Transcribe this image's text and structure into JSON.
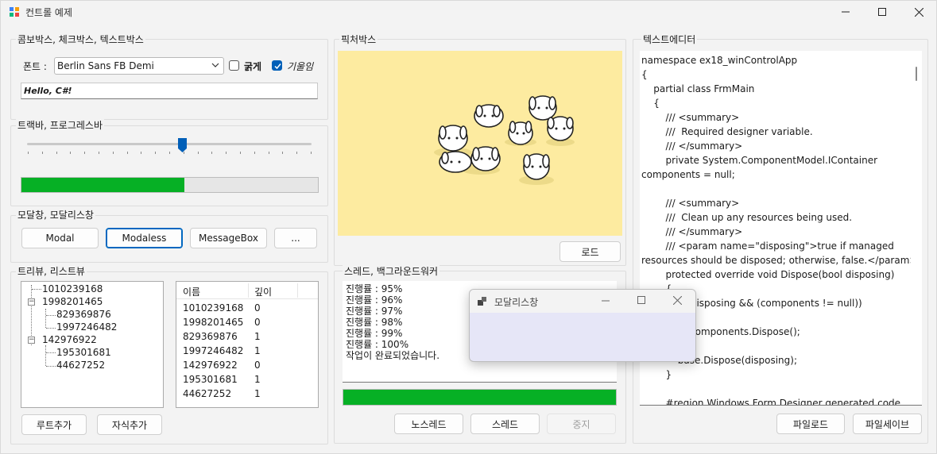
{
  "window": {
    "title": "컨트롤 예제"
  },
  "combo_group": {
    "label": "콤보박스, 체크박스, 텍스트박스",
    "font_label": "폰트 :",
    "font_value": "Berlin Sans FB Demi",
    "bold_label": "굵게",
    "italic_label": "기울임",
    "bold_checked": false,
    "italic_checked": true,
    "sample_text": "Hello, C#!"
  },
  "track_group": {
    "label": "트랙바, 프로그레스바",
    "progress_fraction": 0.55
  },
  "modal_group": {
    "label": "모달창, 모달리스창",
    "buttons": [
      "Modal",
      "Modaless",
      "MessageBox",
      "..."
    ]
  },
  "tree_group": {
    "label": "트리뷰, 리스트뷰",
    "tree": [
      {
        "text": "1010239168",
        "level": 0,
        "expander": ""
      },
      {
        "text": "1998201465",
        "level": 0,
        "expander": "−"
      },
      {
        "text": "829369876",
        "level": 1,
        "expander": ""
      },
      {
        "text": "1997246482",
        "level": 1,
        "expander": ""
      },
      {
        "text": "142976922",
        "level": 0,
        "expander": "−"
      },
      {
        "text": "195301681",
        "level": 1,
        "expander": ""
      },
      {
        "text": "44627252",
        "level": 1,
        "expander": ""
      }
    ],
    "list_headers": [
      "이름",
      "깊이"
    ],
    "list_rows": [
      [
        "1010239168",
        "0"
      ],
      [
        "1998201465",
        "0"
      ],
      [
        "829369876",
        "1"
      ],
      [
        "1997246482",
        "1"
      ],
      [
        "142976922",
        "0"
      ],
      [
        "195301681",
        "1"
      ],
      [
        "44627252",
        "1"
      ]
    ],
    "add_root": "루트추가",
    "add_child": "자식추가"
  },
  "picture_group": {
    "label": "픽처박스",
    "load_button": "로드"
  },
  "thread_group": {
    "label": "스레드, 백그라운드워커",
    "log": [
      "진행률 : 95%",
      "진행률 : 96%",
      "진행률 : 97%",
      "진행률 : 98%",
      "진행률 : 99%",
      "진행률 : 100%",
      "작업이 완료되었습니다."
    ],
    "progress_fraction": 1.0,
    "buttons": [
      "노스레드",
      "스레드",
      "중지"
    ]
  },
  "editor_group": {
    "label": "텍스트에디터",
    "lines": [
      "namespace ex18_winControlApp",
      "{",
      "    partial class FrmMain",
      "    {",
      "        /// <summary>",
      "        ///  Required designer variable.",
      "        /// </summary>",
      "        private System.ComponentModel.IContainer",
      "components = null;",
      "",
      "        /// <summary>",
      "        ///  Clean up any resources being used.",
      "        /// </summary>",
      "        /// <param name=\"disposing\">true if managed",
      "resources should be disposed; otherwise, false.</param>",
      "        protected override void Dispose(bool disposing)",
      "        {",
      "            if (disposing && (components != null))",
      "            {",
      "                components.Dispose();",
      "            }",
      "            base.Dispose(disposing);",
      "        }",
      "",
      "        #region Windows Form Designer generated code"
    ],
    "load_button": "파일로드",
    "save_button": "파일세이브"
  },
  "modeless_window": {
    "title": "모달리스창"
  },
  "colors": {
    "accent": "#005fb8",
    "progress": "#06b025",
    "picture_bg": "#fdeba0"
  }
}
